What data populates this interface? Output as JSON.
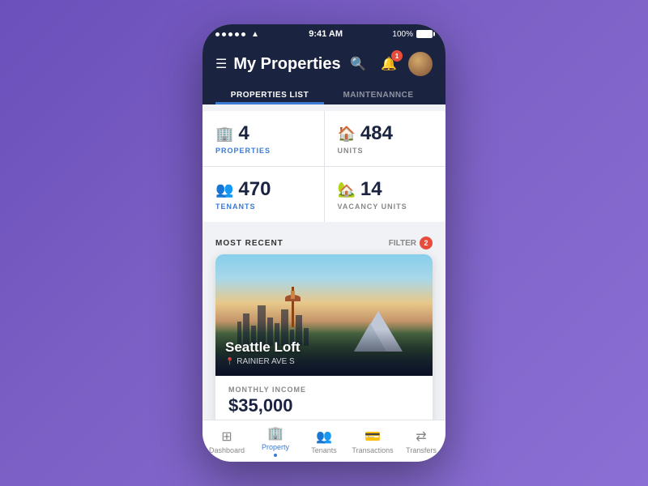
{
  "status_bar": {
    "time": "9:41 AM",
    "battery": "100%"
  },
  "header": {
    "title": "My Properties",
    "notification_badge": "1"
  },
  "tabs": [
    {
      "id": "properties",
      "label": "PROPERTIES LIST",
      "active": true
    },
    {
      "id": "maintenance",
      "label": "MAINTENANNCE",
      "active": false
    }
  ],
  "stats": [
    {
      "id": "properties",
      "icon": "🏢",
      "number": "4",
      "label": "PROPERTIES",
      "label_class": "blue"
    },
    {
      "id": "units",
      "icon": "🏠",
      "number": "484",
      "label": "UNITS",
      "label_class": "gray"
    },
    {
      "id": "tenants",
      "icon": "👥",
      "number": "470",
      "label": "TENANTS",
      "label_class": "blue"
    },
    {
      "id": "vacancy",
      "icon": "🏡",
      "number": "14",
      "label": "VACANCY UNITS",
      "label_class": "gray"
    }
  ],
  "section": {
    "title": "MOST RECENT",
    "filter_label": "FILTER",
    "filter_badge": "2"
  },
  "property_card": {
    "name": "Seattle Loft",
    "address": "RAINIER AVE S",
    "income_label": "MONTHLY INCOME",
    "income_amount": "$35,000"
  },
  "bottom_nav": [
    {
      "id": "dashboard",
      "label": "Dashboard",
      "icon": "⊞",
      "active": false
    },
    {
      "id": "property",
      "label": "Property",
      "icon": "🏢",
      "active": true
    },
    {
      "id": "tenants",
      "label": "Tenants",
      "icon": "👥",
      "active": false
    },
    {
      "id": "transactions",
      "label": "Transactions",
      "icon": "💳",
      "active": false
    },
    {
      "id": "transfers",
      "label": "Transfers",
      "icon": "⇄",
      "active": false
    }
  ],
  "colors": {
    "primary": "#1a2340",
    "accent": "#3a7bd5",
    "danger": "#e74c3c"
  }
}
